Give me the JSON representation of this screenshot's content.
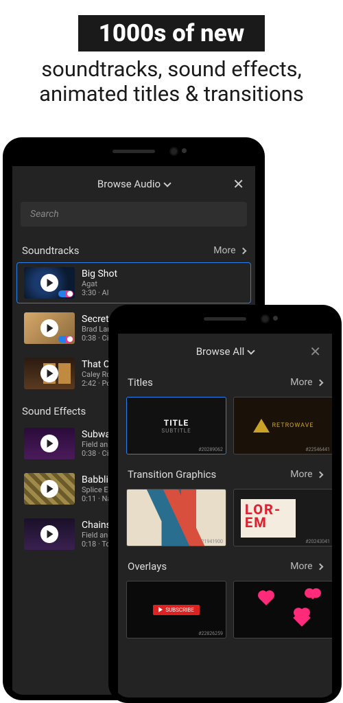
{
  "hero": {
    "line1": "1000s of new",
    "line2": "soundtracks, sound effects,",
    "line3": "animated titles & transitions"
  },
  "phone1": {
    "title": "Browse Audio",
    "search_placeholder": "Search",
    "sections": {
      "soundtracks": {
        "label": "Soundtracks",
        "more": "More"
      },
      "sound_effects": {
        "label": "Sound Effects"
      }
    },
    "tracks": [
      {
        "title": "Big Shot",
        "artist": "Agat",
        "dur": "3:30 · Al"
      },
      {
        "title": "Secret",
        "artist": "Brad Lan",
        "dur": "0:38 · Ci"
      },
      {
        "title": "That C",
        "artist": "Caley Ro",
        "dur": "2:42 · Po"
      }
    ],
    "effects": [
      {
        "title": "Subwa",
        "artist": "Field an",
        "dur": "0:38 · Ci"
      },
      {
        "title": "Babbli",
        "artist": "Splice Ex",
        "dur": "0:11 · Na"
      },
      {
        "title": "Chains",
        "artist": "Field an",
        "dur": "0:18 · To"
      }
    ]
  },
  "phone2": {
    "title": "Browse All",
    "sections": {
      "titles": {
        "label": "Titles",
        "more": "More"
      },
      "transitions": {
        "label": "Transition Graphics",
        "more": "More"
      },
      "overlays": {
        "label": "Overlays",
        "more": "More"
      }
    },
    "title_card": {
      "t1": "TITLE",
      "t2": "SUBTITLE"
    },
    "retro_label": "RETROWAVE",
    "lorem": "LOR-EM",
    "subscribe": "SUBSCRIBE"
  }
}
